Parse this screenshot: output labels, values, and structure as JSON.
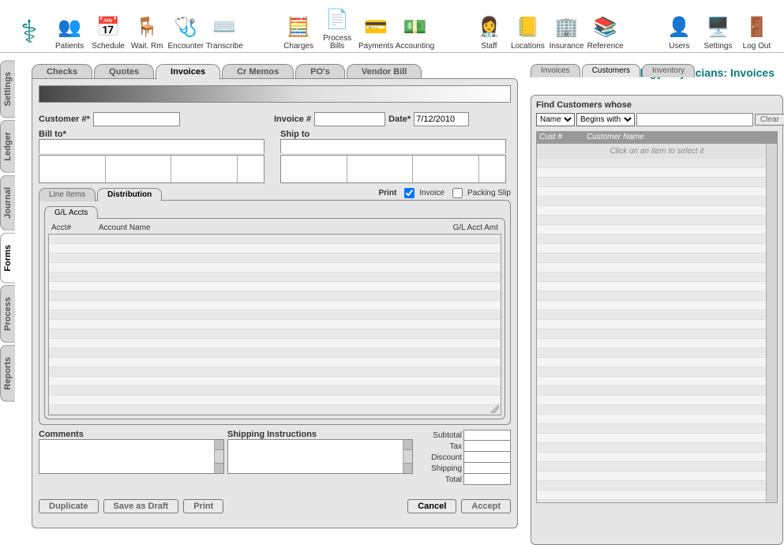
{
  "page_title_prefix": "Cardiology Physicians:",
  "page_title_suffix": "Invoices",
  "toolbar": [
    {
      "label": "Patients",
      "icon": "👥"
    },
    {
      "label": "Schedule",
      "icon": "📅"
    },
    {
      "label": "Wait. Rm",
      "icon": "🪑"
    },
    {
      "label": "Encounter",
      "icon": "🩺"
    },
    {
      "label": "Transcribe",
      "icon": "⌨️"
    },
    {
      "gap": true
    },
    {
      "label": "Charges",
      "icon": "🧮"
    },
    {
      "label": "Process Bills",
      "icon": "📄"
    },
    {
      "label": "Payments",
      "icon": "💳"
    },
    {
      "label": "Accounting",
      "icon": "💵"
    },
    {
      "gap": true
    },
    {
      "label": "Staff",
      "icon": "👩‍⚕️"
    },
    {
      "label": "Locations",
      "icon": "📒"
    },
    {
      "label": "Insurance",
      "icon": "🏢"
    },
    {
      "label": "Reference",
      "icon": "📚"
    },
    {
      "gap": true
    },
    {
      "label": "Users",
      "icon": "👤"
    },
    {
      "label": "Settings",
      "icon": "🖥️"
    },
    {
      "label": "Log Out",
      "icon": "🚪"
    }
  ],
  "sidetabs": [
    "Settings",
    "Ledger",
    "Journal",
    "Forms",
    "Process",
    "Reports"
  ],
  "sidetab_active": "Forms",
  "doctabs": [
    "Checks",
    "Quotes",
    "Invoices",
    "Cr Memos",
    "PO's",
    "Vendor Bill"
  ],
  "doctab_active": "Invoices",
  "form": {
    "customer_no_label": "Customer #",
    "customer_no": "",
    "invoice_no_label": "Invoice #",
    "invoice_no": "",
    "date_label": "Date",
    "date": "7/12/2010",
    "bill_to_label": "Bill to",
    "ship_to_label": "Ship to"
  },
  "subtabs": [
    "Line Items",
    "Distribution"
  ],
  "subtab_active": "Distribution",
  "print_label": "Print",
  "print_opts": {
    "invoice_label": "Invoice",
    "invoice_checked": true,
    "packing_label": "Packing Slip",
    "packing_checked": false
  },
  "minitabs": [
    "G/L Accts"
  ],
  "gl_columns": {
    "acct": "Acct#",
    "name": "Account Name",
    "amt": "G/L Acct Amt"
  },
  "comments_label": "Comments",
  "shipinst_label": "Shipping Instructions",
  "totals": {
    "subtotal": "Subtotal",
    "tax": "Tax",
    "discount": "Discount",
    "shipping": "Shipping",
    "total": "Total"
  },
  "buttons": {
    "duplicate": "Duplicate",
    "save": "Save as Draft",
    "print": "Print",
    "cancel": "Cancel",
    "accept": "Accept"
  },
  "side": {
    "tabs": [
      "Invoices",
      "Customers",
      "Inventory"
    ],
    "tab_active": "Customers",
    "find_label": "Find Customers whose",
    "field_sel": "Name",
    "op_sel": "Begins with",
    "search": "",
    "clear": "Clear",
    "grid_cols": {
      "cust": "Cust #",
      "name": "Customer Name"
    },
    "hint": "Click on an item to select it"
  }
}
